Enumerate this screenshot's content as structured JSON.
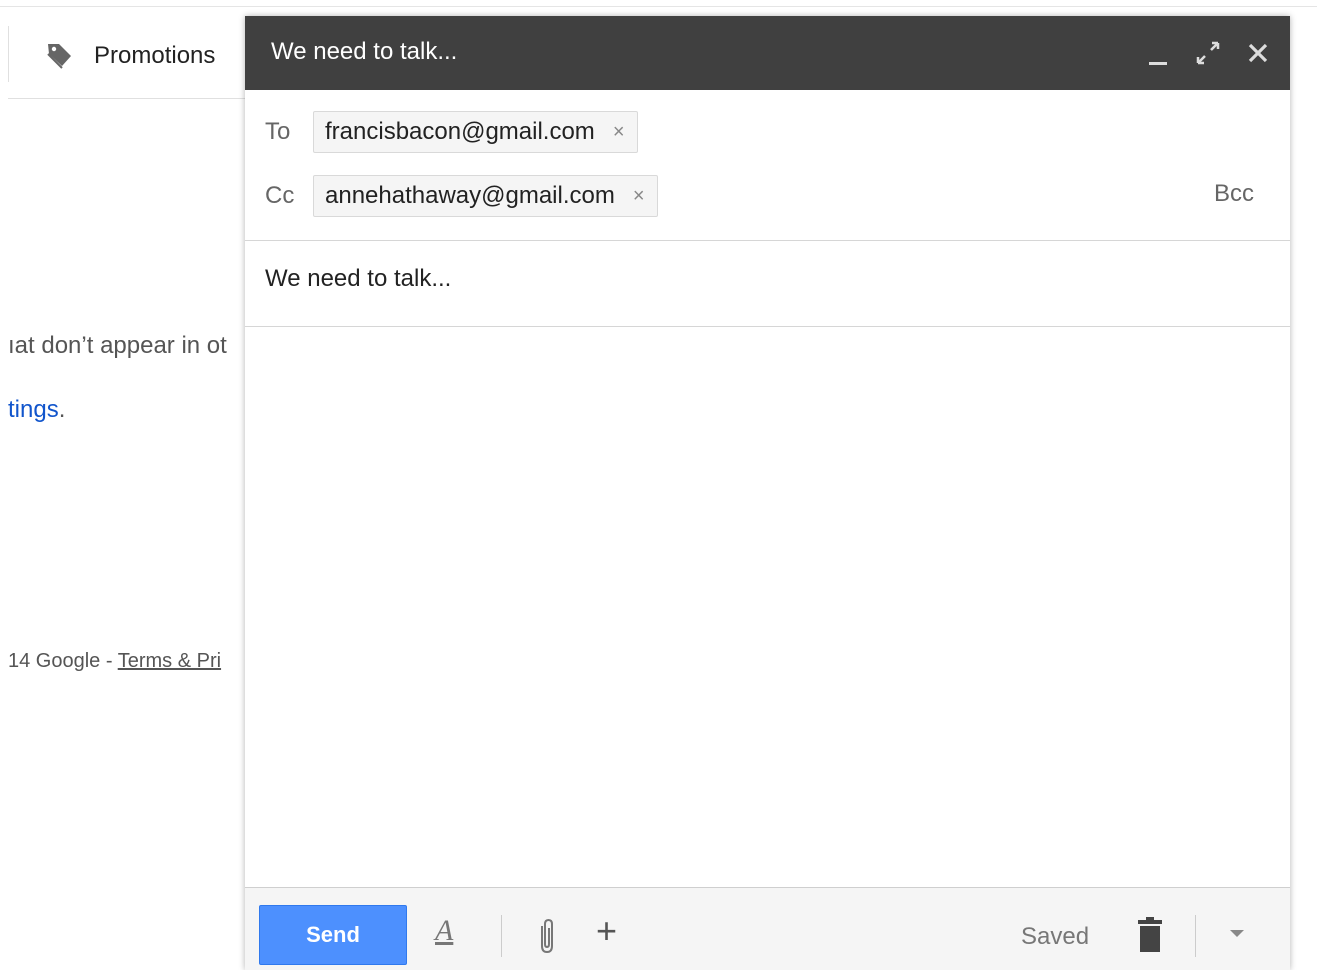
{
  "background": {
    "tab_promotions": {
      "label": "Promotions",
      "icon": "tag-icon"
    },
    "partial_text": "ıat don’t appear in ot",
    "partial_link": "tings",
    "partial_link_suffix": ".",
    "footer": {
      "prefix": "14 Google - ",
      "terms": "Terms & Pri"
    }
  },
  "compose": {
    "title": "We need to talk...",
    "header_icons": [
      "minimize-icon",
      "expand-icon",
      "close-icon"
    ],
    "to_label": "To",
    "to_recipients": [
      "francisbacon@gmail.com"
    ],
    "cc_label": "Cc",
    "cc_recipients": [
      "annehathaway@gmail.com"
    ],
    "remove_symbol": "×",
    "bcc_label": "Bcc",
    "subject": "We need to talk...",
    "body": "",
    "footer": {
      "send_label": "Send",
      "format_icon": "A",
      "plus_icon": "+",
      "status": "Saved"
    }
  },
  "colors": {
    "header_bg": "#404040",
    "send_bg": "#4d90fe",
    "link": "#1155cc"
  }
}
